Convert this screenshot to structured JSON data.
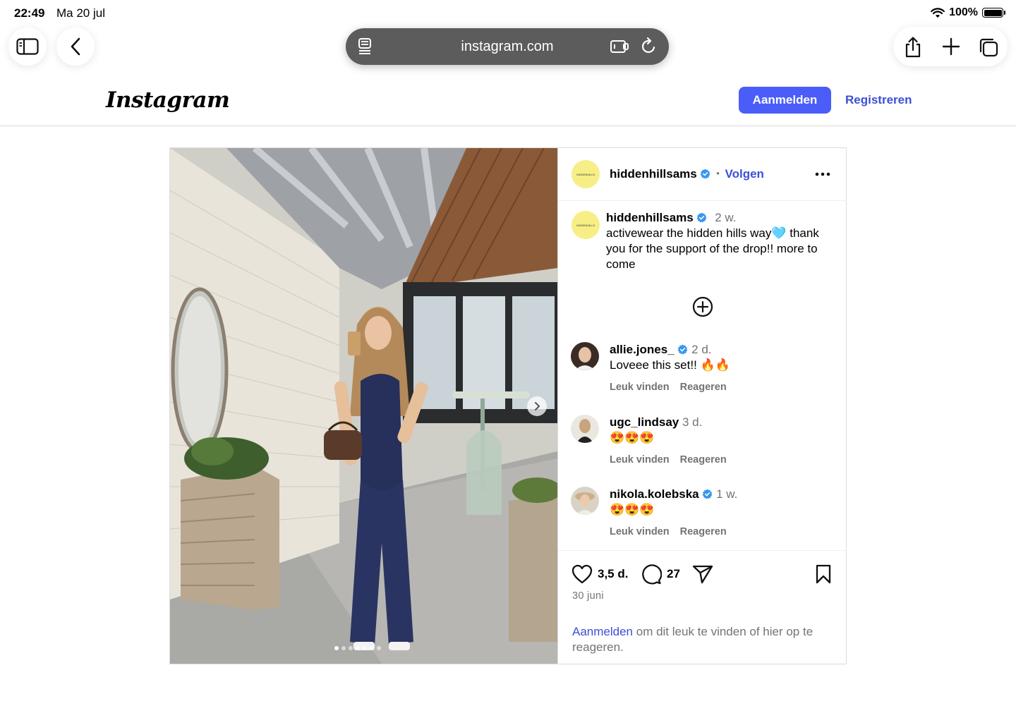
{
  "status": {
    "time": "22:49",
    "date": "Ma 20 jul",
    "battery": "100%"
  },
  "browser": {
    "url": "instagram.com"
  },
  "header": {
    "logo": "Instagram",
    "login": "Aanmelden",
    "register": "Registreren"
  },
  "post": {
    "author": "hiddenhillsams",
    "avatar_text": "HIDDENHILLS",
    "follow": "Volgen",
    "separator": "•",
    "caption": {
      "user": "hiddenhillsams",
      "age": "2 w.",
      "text": "activewear the hidden hills way🩵 thank you for the support of the drop!! more to come"
    },
    "carousel": {
      "slides": 7,
      "active": 1
    },
    "comments": [
      {
        "user": "allie.jones_",
        "verified": true,
        "age": "2 d.",
        "text": "Loveee this set!! 🔥🔥",
        "like": "Leuk vinden",
        "reply": "Reageren"
      },
      {
        "user": "ugc_lindsay",
        "verified": false,
        "age": "3 d.",
        "text": "😍😍😍",
        "like": "Leuk vinden",
        "reply": "Reageren"
      },
      {
        "user": "nikola.kolebska",
        "verified": true,
        "age": "1 w.",
        "text": "😍😍😍",
        "like": "Leuk vinden",
        "reply": "Reageren"
      }
    ],
    "likes": "3,5 d.",
    "comment_count": "27",
    "date": "30 juni",
    "login_prompt": {
      "link": "Aanmelden",
      "text": " om dit leuk te vinden of hier op te reageren."
    }
  },
  "colors": {
    "accent": "#4a5df9",
    "link": "#3b4fd8",
    "verified": "#3897f0",
    "muted": "#737373"
  }
}
